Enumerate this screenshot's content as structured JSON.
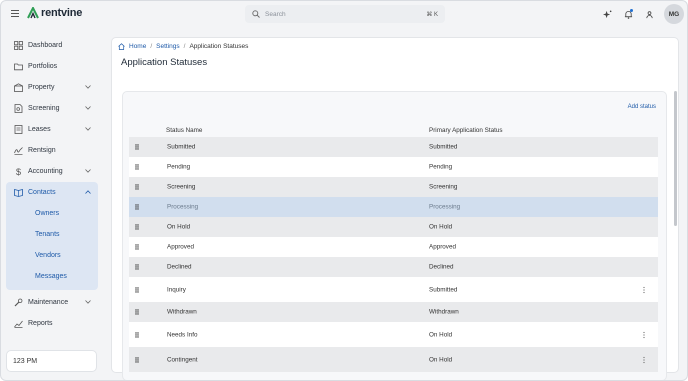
{
  "app": {
    "logo_text": "rentvine"
  },
  "search": {
    "placeholder": "Search",
    "shortcut": "⌘ K"
  },
  "user": {
    "initials": "MG"
  },
  "sidebar": {
    "items": [
      {
        "label": "Dashboard",
        "icon": "dashboard-icon"
      },
      {
        "label": "Portfolios",
        "icon": "folder-icon"
      },
      {
        "label": "Property",
        "icon": "building-icon",
        "expandable": true
      },
      {
        "label": "Screening",
        "icon": "document-search-icon",
        "expandable": true
      },
      {
        "label": "Leases",
        "icon": "lease-icon",
        "expandable": true
      },
      {
        "label": "Rentsign",
        "icon": "signature-icon"
      },
      {
        "label": "Accounting",
        "icon": "dollar-icon",
        "expandable": true
      }
    ],
    "contacts": {
      "label": "Contacts",
      "icon": "contacts-icon",
      "children": [
        "Owners",
        "Tenants",
        "Vendors",
        "Messages"
      ]
    },
    "bottom_items": [
      {
        "label": "Maintenance",
        "icon": "wrench-icon",
        "expandable": true
      },
      {
        "label": "Reports",
        "icon": "chart-icon"
      }
    ],
    "clock": "123 PM"
  },
  "breadcrumb": {
    "home": "Home",
    "settings": "Settings",
    "current": "Application Statuses"
  },
  "page": {
    "title": "Application Statuses",
    "add_label": "Add status"
  },
  "table": {
    "headers": {
      "name": "Status Name",
      "primary": "Primary Application Status"
    },
    "rows": [
      {
        "name": "Submitted",
        "primary": "Submitted"
      },
      {
        "name": "Pending",
        "primary": "Pending"
      },
      {
        "name": "Screening",
        "primary": "Screening"
      },
      {
        "name": "Processing",
        "primary": "Processing"
      },
      {
        "name": "On Hold",
        "primary": "On Hold"
      },
      {
        "name": "Approved",
        "primary": "Approved"
      },
      {
        "name": "Declined",
        "primary": "Declined"
      },
      {
        "name": "Inquiry",
        "primary": "Submitted"
      },
      {
        "name": "Withdrawn",
        "primary": "Withdrawn"
      },
      {
        "name": "Needs Info",
        "primary": "On Hold"
      },
      {
        "name": "Contingent",
        "primary": "On Hold"
      }
    ]
  },
  "colors": {
    "accent": "#1e5aa8",
    "selected_row": "#d1deee",
    "brand_green": "#2f9e55"
  }
}
